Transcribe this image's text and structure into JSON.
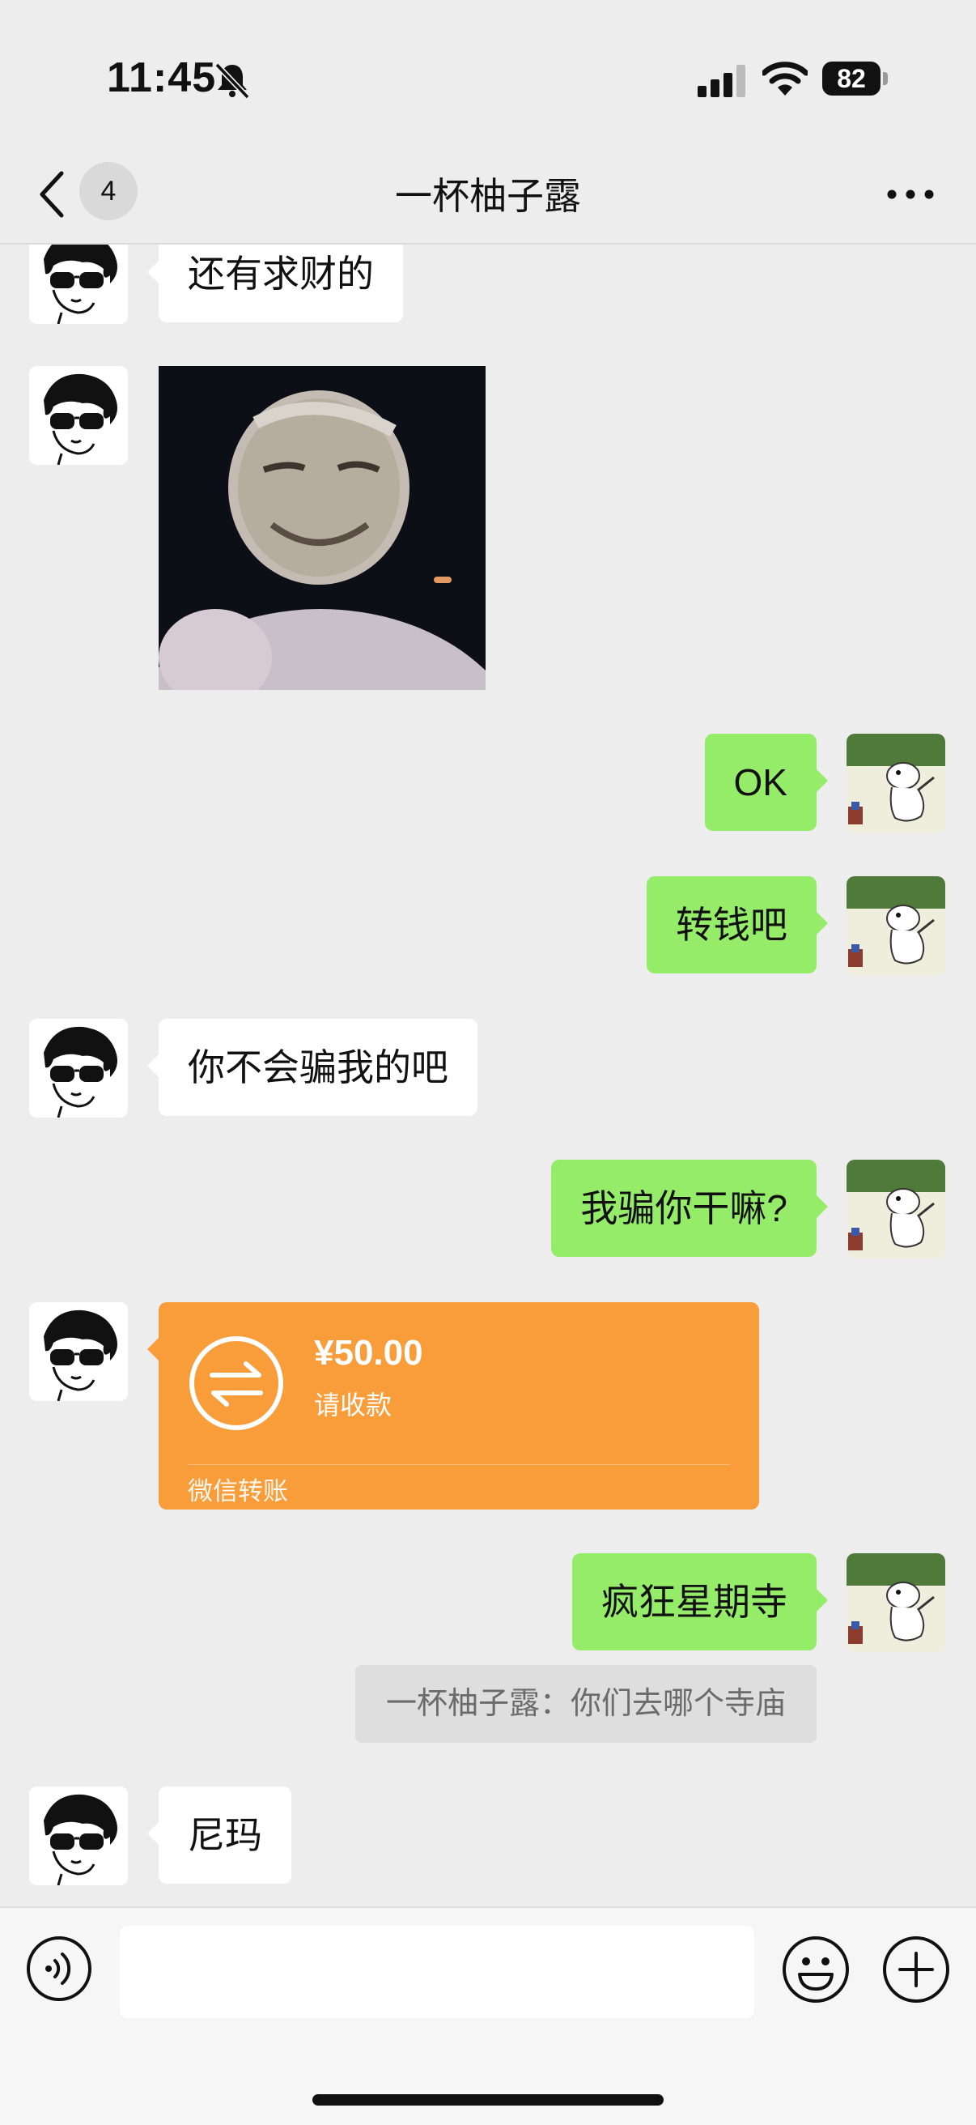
{
  "status_bar": {
    "time": "11:45",
    "battery": "82",
    "icons": [
      "bell-slash-icon",
      "cellular-signal-icon",
      "wifi-icon",
      "battery-icon"
    ]
  },
  "nav": {
    "unread_count": "4",
    "title": "一杯柚子露",
    "icons": [
      "back-chevron-icon",
      "more-dots-icon"
    ]
  },
  "messages": [
    {
      "side": "left",
      "type": "text",
      "text": "还有求财的"
    },
    {
      "side": "left",
      "type": "image",
      "alt": ""
    },
    {
      "side": "right",
      "type": "text",
      "text": "OK"
    },
    {
      "side": "right",
      "type": "text",
      "text": "转钱吧"
    },
    {
      "side": "left",
      "type": "text",
      "text": "你不会骗我的吧"
    },
    {
      "side": "right",
      "type": "text",
      "text": "我骗你干嘛?"
    },
    {
      "side": "left",
      "type": "transfer",
      "amount": "¥50.00",
      "status": "请收款",
      "label": "微信转账"
    },
    {
      "side": "right",
      "type": "text",
      "text": "疯狂星期寺"
    },
    {
      "side": "right",
      "type": "quote",
      "text": "一杯柚子露：你们去哪个寺庙"
    },
    {
      "side": "left",
      "type": "text",
      "text": "尼玛"
    }
  ],
  "input_bar": {
    "placeholder": "",
    "icons": [
      "voice-icon",
      "emoji-icon",
      "plus-icon"
    ]
  },
  "colors": {
    "background": "#ededed",
    "bubble_mine": "#95ec69",
    "bubble_theirs": "#ffffff",
    "transfer": "#f99c3a"
  }
}
